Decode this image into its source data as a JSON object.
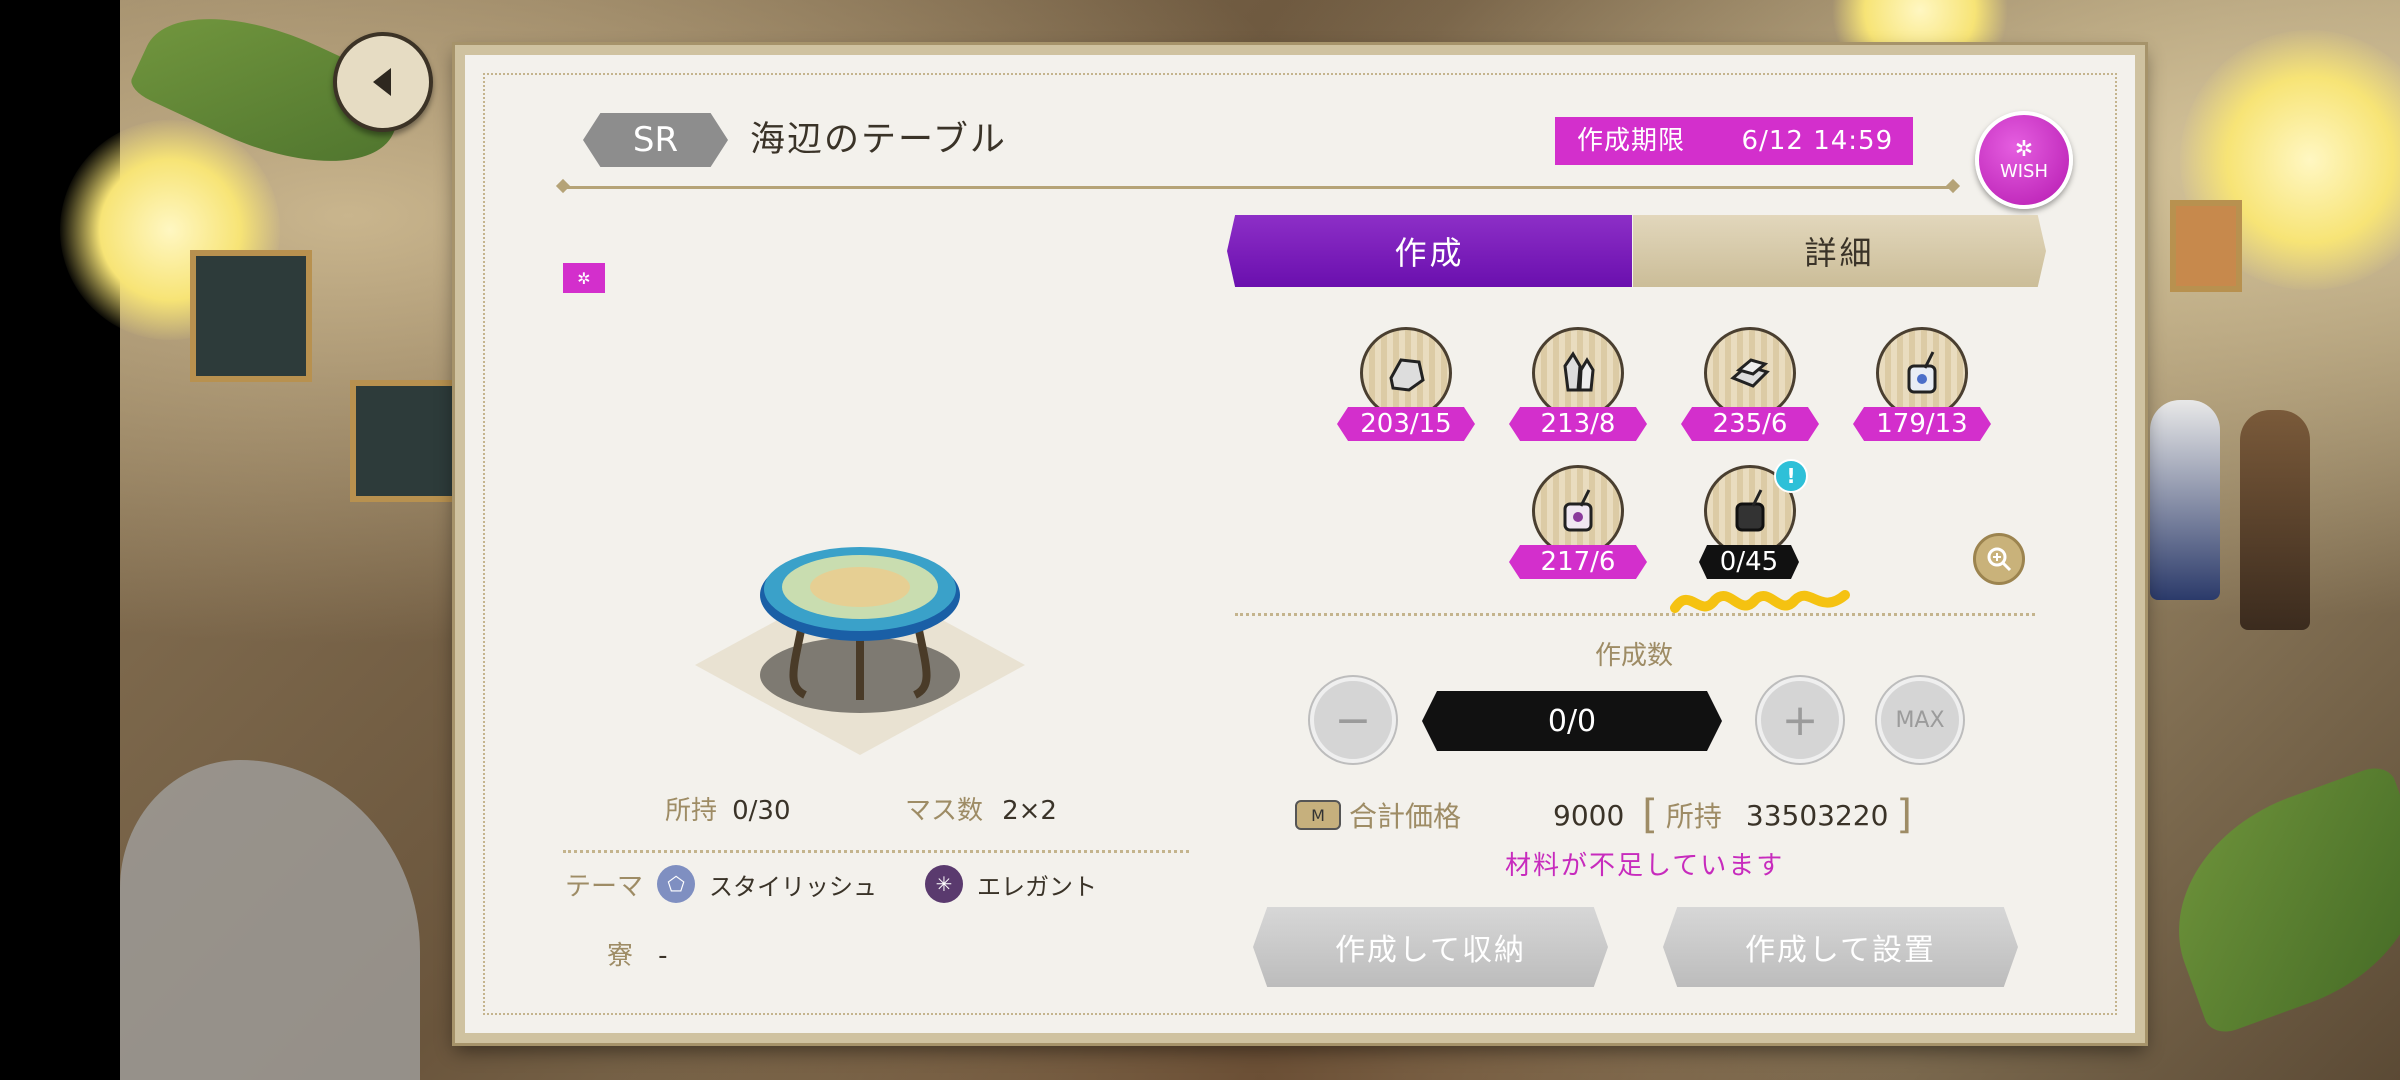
{
  "item": {
    "rarity": "SR",
    "name": "海辺のテーブル",
    "deadline_label": "作成期限",
    "deadline_value": "6/12 14:59",
    "wish_label": "WISH"
  },
  "tabs": {
    "create": "作成",
    "detail": "詳細"
  },
  "info": {
    "owned_label": "所持",
    "owned_value": "0/30",
    "masu_label": "マス数",
    "masu_value": "2×2",
    "theme_label": "テーマ",
    "themes": [
      "スタイリッシュ",
      "エレガント"
    ],
    "dorm_label": "寮",
    "dorm_value": "-"
  },
  "materials": [
    {
      "icon": "stone-icon",
      "count": "203/15"
    },
    {
      "icon": "crystal-icon",
      "count": "213/8"
    },
    {
      "icon": "ingot-icon",
      "count": "235/6"
    },
    {
      "icon": "blue-jar-icon",
      "count": "179/13"
    },
    {
      "icon": "purple-jar-icon",
      "count": "217/6"
    },
    {
      "icon": "dark-paint-icon",
      "count": "0/45",
      "alert": "!"
    }
  ],
  "quantity": {
    "label": "作成数",
    "value": "0/0",
    "minus": "−",
    "plus": "+",
    "max": "MAX"
  },
  "price": {
    "currency": "M",
    "label": "合計価格",
    "value": "9000",
    "owned_label": "所持",
    "owned_value": "33503220",
    "bracket_open": "[",
    "bracket_close": "]"
  },
  "warning": "材料が不足しています",
  "actions": {
    "store": "作成して収納",
    "place": "作成して設置"
  },
  "colors": {
    "accent": "#d32fcc",
    "tab_active": "#6a0fae",
    "panel": "#f3f1ec"
  }
}
